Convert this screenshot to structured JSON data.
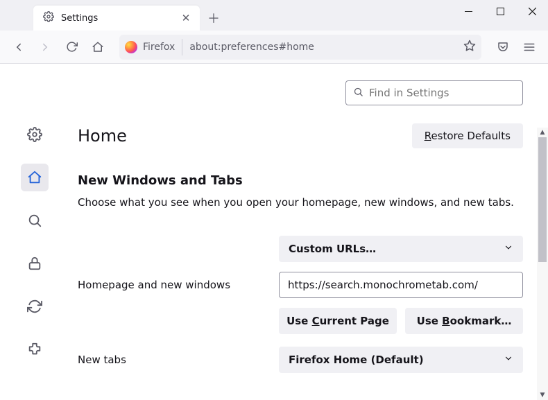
{
  "tab": {
    "title": "Settings"
  },
  "toolbar": {
    "identity_label": "Firefox",
    "url": "about:preferences#home"
  },
  "search": {
    "placeholder": "Find in Settings"
  },
  "header": {
    "title": "Home",
    "restore_label": "Restore Defaults"
  },
  "section": {
    "title": "New Windows and Tabs",
    "desc": "Choose what you see when you open your homepage, new windows, and new tabs."
  },
  "form": {
    "homepage_label": "Homepage and new windows",
    "homepage_dropdown": "Custom URLs…",
    "homepage_url": "https://search.monochrometab.com/",
    "use_current": "Use Current Page",
    "use_bookmark": "Use Bookmark…",
    "newtabs_label": "New tabs",
    "newtabs_dropdown": "Firefox Home (Default)"
  }
}
